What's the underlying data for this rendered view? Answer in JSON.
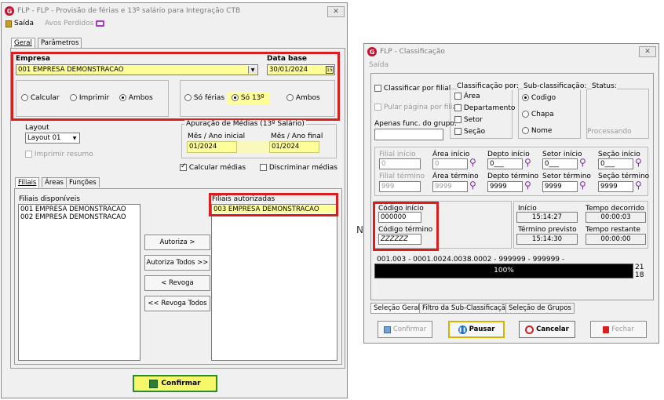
{
  "left": {
    "title": "FLP - FLP - Provisão de férias e 13º salário para Integração CTB",
    "logo": "G",
    "menu": {
      "exit": "Saída",
      "notices": "Avos Perdidos"
    },
    "tabs": {
      "general": "Geral",
      "parameters": "Parâmetros"
    },
    "company": {
      "label": "Empresa",
      "value": "001 EMPRESA DEMONSTRACAO"
    },
    "base_date": {
      "label": "Data base",
      "value": "30/01/2024"
    },
    "mode": {
      "calc": "Calcular",
      "print": "Imprimir",
      "both": "Ambos",
      "selected": "Ambos"
    },
    "type": {
      "vacation": "Só férias",
      "thirteenth": "Só 13º",
      "both": "Ambos",
      "selected": "Só 13º"
    },
    "layout": {
      "label": "Layout",
      "value": "Layout 01",
      "print_summary": "Imprimir resumo"
    },
    "averages": {
      "label": "Apuração de Médias (13º Salário)",
      "start_label": "Mês / Ano inicial",
      "start": "01/2024",
      "end_label": "Mês / Ano final",
      "end": "01/2024"
    },
    "checks": {
      "calc_avg": "Calcular médias",
      "disc_avg": "Discriminar médias"
    },
    "subtabs": {
      "branches": "Filiais",
      "areas": "Áreas",
      "functions": "Funções"
    },
    "available": {
      "label": "Filiais disponíveis",
      "items": [
        "001 EMPRESA DEMONSTRACAO",
        "002 EMPRESA DEMONSTRACAO"
      ]
    },
    "authorized": {
      "label": "Filiais autorizadas",
      "items": [
        "003 EMPRESA DEMONSTRACAO"
      ]
    },
    "buttons": {
      "authorize": "Autoriza >",
      "authorize_all": "Autoriza Todos >>",
      "revoke": "< Revoga",
      "revoke_all": "<< Revoga Todos",
      "confirm": "Confirmar"
    }
  },
  "stray_letter": "N",
  "right": {
    "title": "FLP - Classificação",
    "menu": {
      "exit": "Saída"
    },
    "checks": {
      "by_branch": "Classificar por filial",
      "skip_page": "Pular página por filial",
      "only_group": "Apenas func. do grupo:"
    },
    "classification": {
      "label": "Classificação  por:",
      "items": [
        "Área",
        "Departamento",
        "Setor",
        "Seção"
      ]
    },
    "subclass": {
      "label": "Sub-classificação:",
      "items": [
        "Codigo",
        "Chapa",
        "Nome"
      ],
      "selected": "Codigo"
    },
    "status": {
      "label": "Status:",
      "value": "Processando"
    },
    "ranges": [
      {
        "start_label": "Filial início",
        "start": "0",
        "end_label": "Filial término",
        "end": "999",
        "disabled": true
      },
      {
        "start_label": "Área início",
        "start": "0",
        "end_label": "Área término",
        "end": "9999",
        "disabled": true
      },
      {
        "start_label": "Depto início",
        "start": "0___",
        "end_label": "Depto término",
        "end": "9999",
        "disabled": false
      },
      {
        "start_label": "Setor início",
        "start": "0___",
        "end_label": "Setor término",
        "end": "9999",
        "disabled": false
      },
      {
        "start_label": "Seção início",
        "start": "0___",
        "end_label": "Seção término",
        "end": "9999",
        "disabled": false
      }
    ],
    "code": {
      "start_label": "Código início",
      "start": "000000",
      "end_label": "Código término",
      "end": "ZZZZZZ"
    },
    "times": {
      "start_label": "Início",
      "start": "15:14:27",
      "elapsed_label": "Tempo decorrido",
      "elapsed": "00:00:03",
      "forecast_label": "Término previsto",
      "forecast": "15:14:30",
      "remaining_label": "Tempo restante",
      "remaining": "00:00:00"
    },
    "progress": {
      "caption": "001.003 - 0001.0024.0038.0002 - 999999 - 999999 -",
      "percent_text": "100%",
      "fraction": 1.0,
      "count1": "21",
      "count2": "18"
    },
    "tabs": {
      "selection": "Seleção Geral",
      "filter": "Filtro da Sub-Classificação",
      "groups": "Seleção de Grupos"
    },
    "buttons": {
      "confirm": "Confirmar",
      "pause": "Pausar",
      "cancel": "Cancelar",
      "close": "Fechar"
    }
  }
}
